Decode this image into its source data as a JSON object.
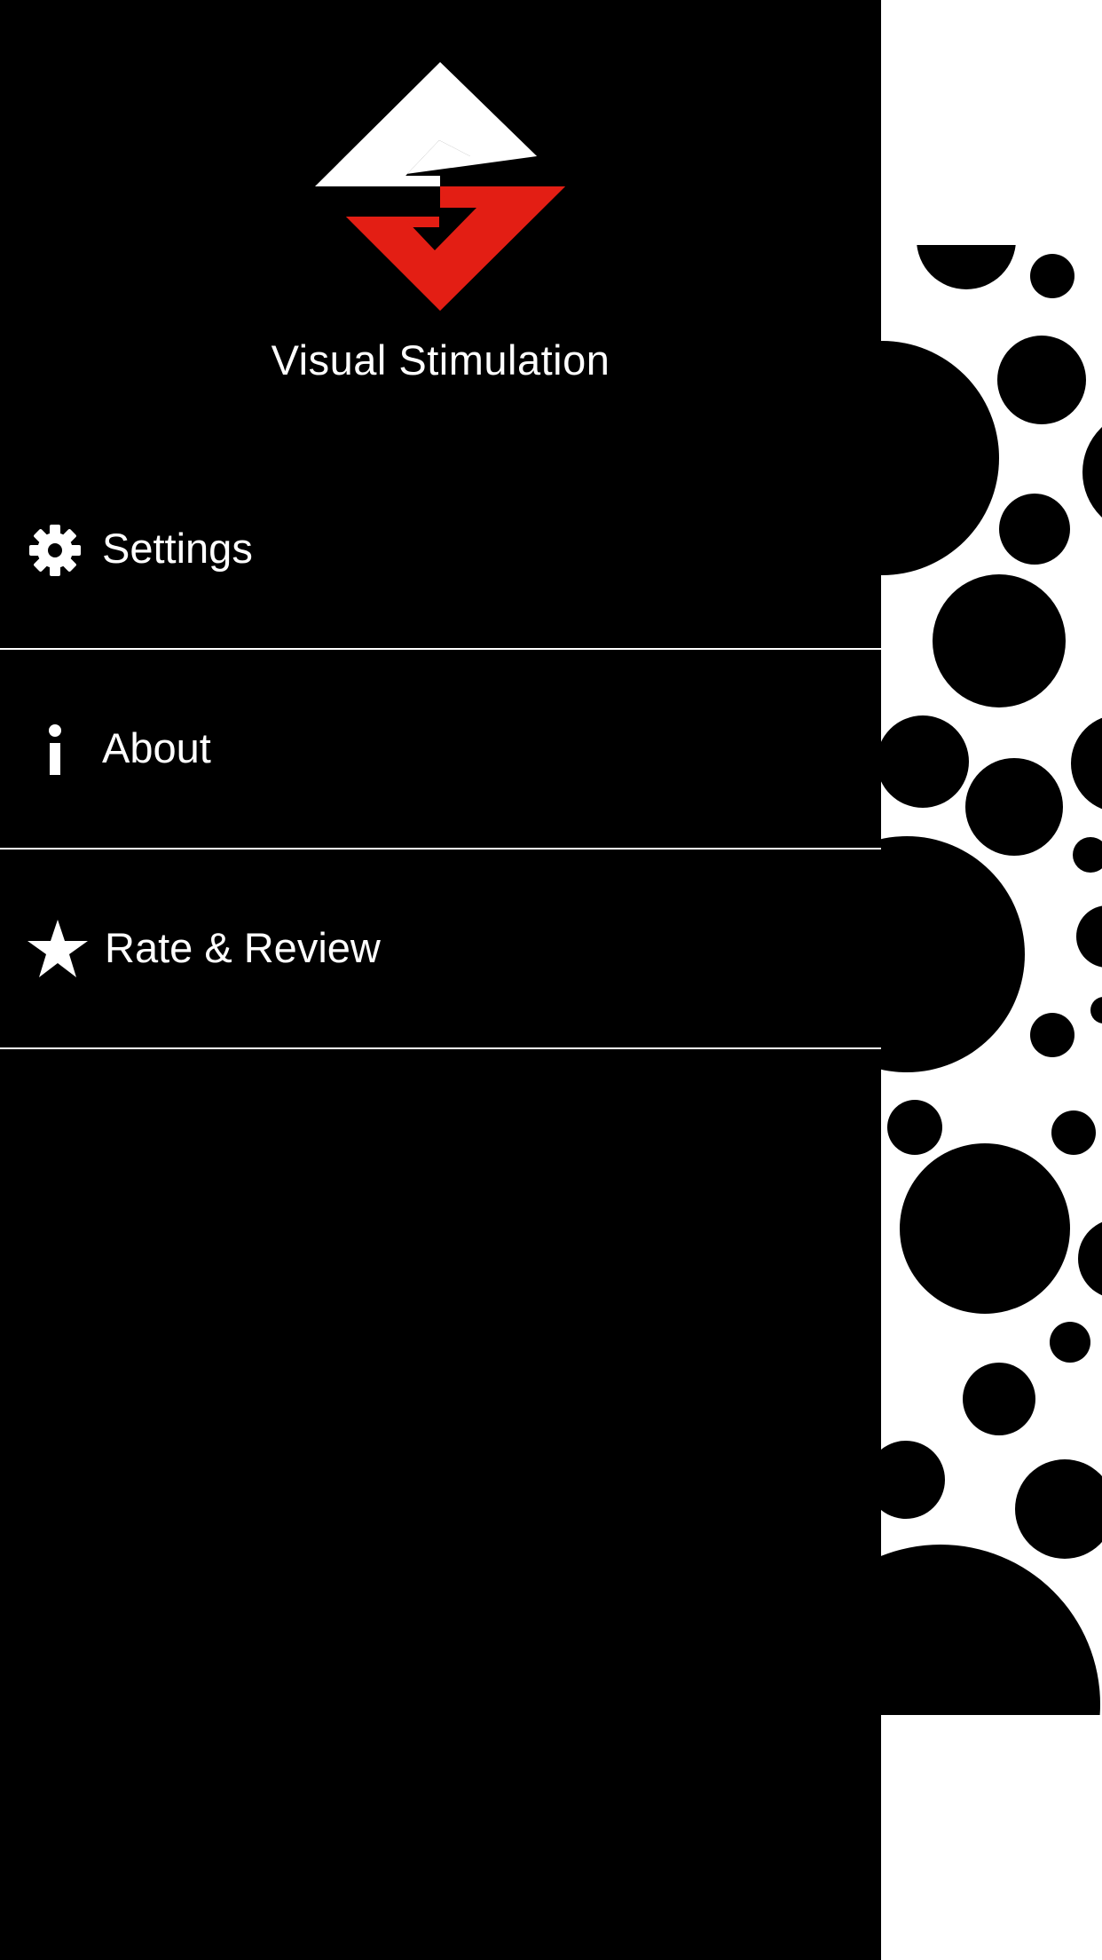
{
  "app": {
    "title": "Visual Stimulation"
  },
  "menu": {
    "items": [
      {
        "label": "Settings",
        "icon": "gear-icon"
      },
      {
        "label": "About",
        "icon": "info-icon"
      },
      {
        "label": "Rate & Review",
        "icon": "star-icon"
      }
    ]
  },
  "colors": {
    "drawer_background": "#000000",
    "text": "#ffffff",
    "logo_top": "#ffffff",
    "logo_bottom": "#e31e14",
    "pattern_background": "#ffffff",
    "pattern_dots": "#000000"
  }
}
